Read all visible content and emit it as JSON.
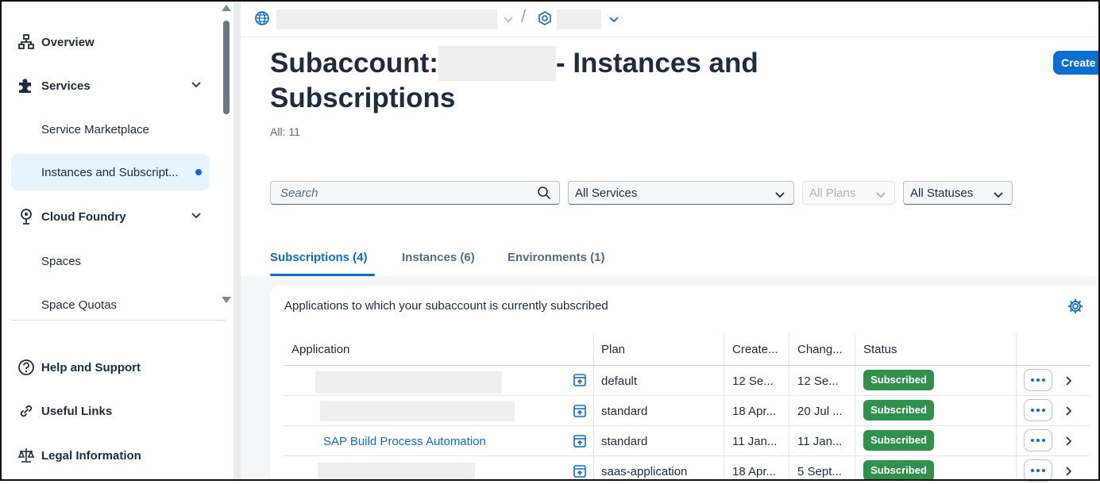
{
  "sidebar": {
    "items": [
      {
        "label": "Overview",
        "icon": "hierarchy-icon"
      },
      {
        "label": "Services",
        "icon": "puzzle-icon"
      },
      {
        "label": "Service Marketplace"
      },
      {
        "label": "Instances and Subscript..."
      },
      {
        "label": "Cloud Foundry",
        "icon": "cloud-foundry-icon"
      },
      {
        "label": "Spaces"
      },
      {
        "label": "Space Quotas"
      }
    ],
    "footer": [
      {
        "label": "Help and Support",
        "icon": "help-icon"
      },
      {
        "label": "Useful Links",
        "icon": "link-icon"
      },
      {
        "label": "Legal Information",
        "icon": "legal-scale-icon"
      }
    ]
  },
  "topbar": {
    "separator": "/"
  },
  "header": {
    "title_prefix": "Subaccount:",
    "title_suffix": "- Instances and Subscriptions",
    "count": "All: 11",
    "create_label": "Create"
  },
  "filters": {
    "search_placeholder": "Search",
    "services": "All Services",
    "plans": "All Plans",
    "statuses": "All Statuses"
  },
  "tabs": [
    {
      "label": "Subscriptions (4)"
    },
    {
      "label": "Instances (6)"
    },
    {
      "label": "Environments (1)"
    }
  ],
  "card": {
    "title": "Applications to which your subaccount is currently subscribed"
  },
  "table": {
    "headers": [
      "Application",
      "Plan",
      "Create...",
      "Chang...",
      "Status"
    ],
    "rows": [
      {
        "application": "",
        "plan": "default",
        "created": "12 Se...",
        "changed": "12 Se...",
        "status": "Subscribed"
      },
      {
        "application": "",
        "plan": "standard",
        "created": "18 Apr...",
        "changed": "20 Jul ...",
        "status": "Subscribed"
      },
      {
        "application": "SAP Build Process Automation",
        "plan": "standard",
        "created": "11 Jan...",
        "changed": "11 Jan...",
        "status": "Subscribed"
      },
      {
        "application": "",
        "plan": "saas-application",
        "created": "18 Apr...",
        "changed": "5 Sept...",
        "status": "Subscribed"
      }
    ]
  },
  "colors": {
    "accent": "#0a6ed1",
    "success": "#30914c",
    "text": "#1d2d3e"
  }
}
